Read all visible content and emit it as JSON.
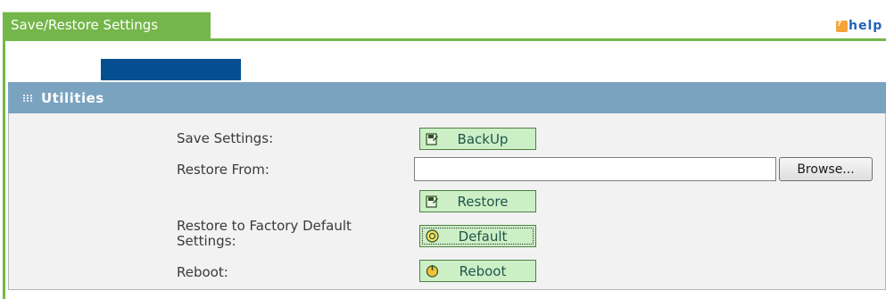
{
  "header": {
    "tab_title": "Save/Restore Settings",
    "help_label": "help",
    "help_icon": "question-icon"
  },
  "section": {
    "title": "Utilities"
  },
  "rows": {
    "save_label": "Save Settings:",
    "restore_label": "Restore From:",
    "factory_label_line1": "Restore to Factory Default",
    "factory_label_line2": "Settings:",
    "reboot_label": "Reboot:"
  },
  "buttons": {
    "backup": "BackUp",
    "restore": "Restore",
    "default": "Default",
    "reboot": "Reboot",
    "browse": "Browse..."
  },
  "file_input": {
    "value": ""
  },
  "colors": {
    "tab_green": "#74b64a",
    "section_blue": "#7aa3c0",
    "dark_blue": "#054f91",
    "button_green": "#ccefc6"
  }
}
